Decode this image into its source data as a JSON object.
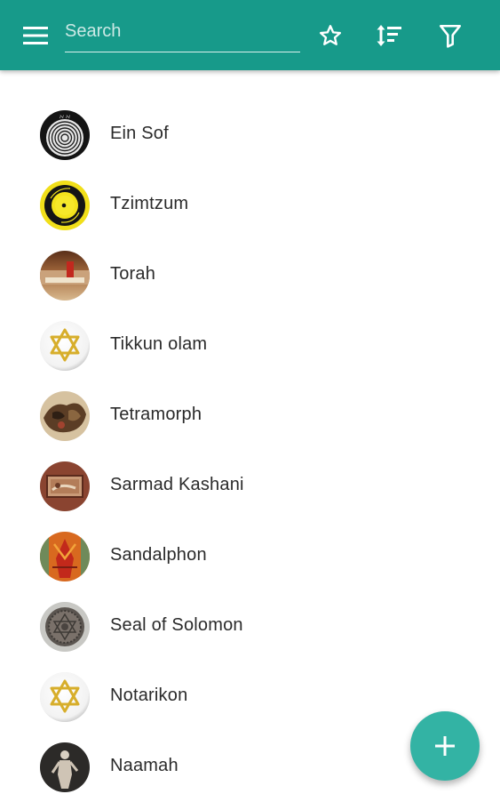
{
  "toolbar": {
    "search": {
      "placeholder": "Search",
      "value": ""
    },
    "icons": [
      "menu-icon",
      "star-icon",
      "sort-icon",
      "filter-icon"
    ],
    "background": "#179a8a"
  },
  "list": {
    "items": [
      {
        "label": "Ein Sof",
        "thumb": "ein-sof-thumbnail"
      },
      {
        "label": "Tzimtzum",
        "thumb": "tzimtzum-thumbnail"
      },
      {
        "label": "Torah",
        "thumb": "torah-thumbnail"
      },
      {
        "label": "Tikkun olam",
        "thumb": "star-of-david-thumbnail"
      },
      {
        "label": "Tetramorph",
        "thumb": "tetramorph-thumbnail"
      },
      {
        "label": "Sarmad Kashani",
        "thumb": "painting-thumbnail"
      },
      {
        "label": "Sandalphon",
        "thumb": "sandalphon-thumbnail"
      },
      {
        "label": "Seal of Solomon",
        "thumb": "seal-thumbnail"
      },
      {
        "label": "Notarikon",
        "thumb": "star-of-david-thumbnail"
      },
      {
        "label": "Naamah",
        "thumb": "statue-thumbnail"
      }
    ]
  },
  "fab": {
    "icon": "plus-icon",
    "color": "#33b3a4"
  }
}
